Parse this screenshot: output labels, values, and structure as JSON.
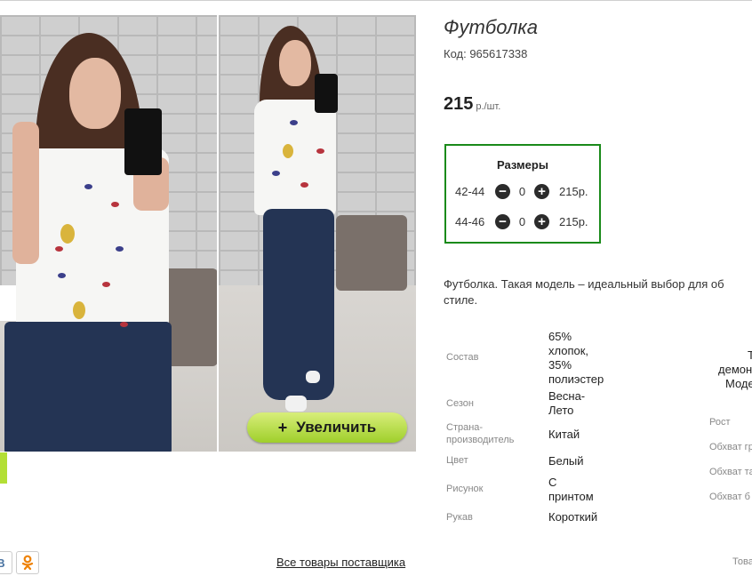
{
  "product": {
    "title": "Футболка",
    "code": "Код: 965617338",
    "price": "215",
    "price_unit": "р./шт."
  },
  "gallery": {
    "zoom_label": "Увеличить",
    "zoom_plus": "+"
  },
  "sizes": {
    "title": "Размеры",
    "rows": [
      {
        "size": "42-44",
        "minus": "−",
        "qty": "0",
        "plus": "+",
        "price": "215р."
      },
      {
        "size": "44-46",
        "minus": "−",
        "qty": "0",
        "plus": "+",
        "price": "215р."
      }
    ]
  },
  "description": {
    "line1": "Футболка. Такая модель – идеальный выбор для об",
    "line2": "стиле."
  },
  "specs": [
    {
      "label": "Состав",
      "value_lines": [
        "65%",
        "хлопок,",
        "35%",
        "полиэстер"
      ]
    },
    {
      "label": "Сезон",
      "value_lines": [
        "Весна-",
        "Лето"
      ]
    },
    {
      "label_lines": [
        "Страна-",
        "производитель"
      ],
      "value": "Китай"
    },
    {
      "label": "Цвет",
      "value": "Белый"
    },
    {
      "label": "Рисунок",
      "value_lines": [
        "С",
        "принтом"
      ]
    },
    {
      "label": "Рукав",
      "value": "Короткий"
    }
  ],
  "right_column": {
    "text_lines": [
      "Т",
      "демон",
      "Моде"
    ],
    "labels": [
      "Рост",
      "Обхват гр",
      "Обхват та",
      "Обхват б"
    ]
  },
  "footer": {
    "vk": "В",
    "ok": "ОК",
    "supplier_link": "Все товары поставщика",
    "right_text": "Това"
  },
  "icons": {
    "minus": "minus-circle-icon",
    "plus": "plus-circle-icon"
  }
}
